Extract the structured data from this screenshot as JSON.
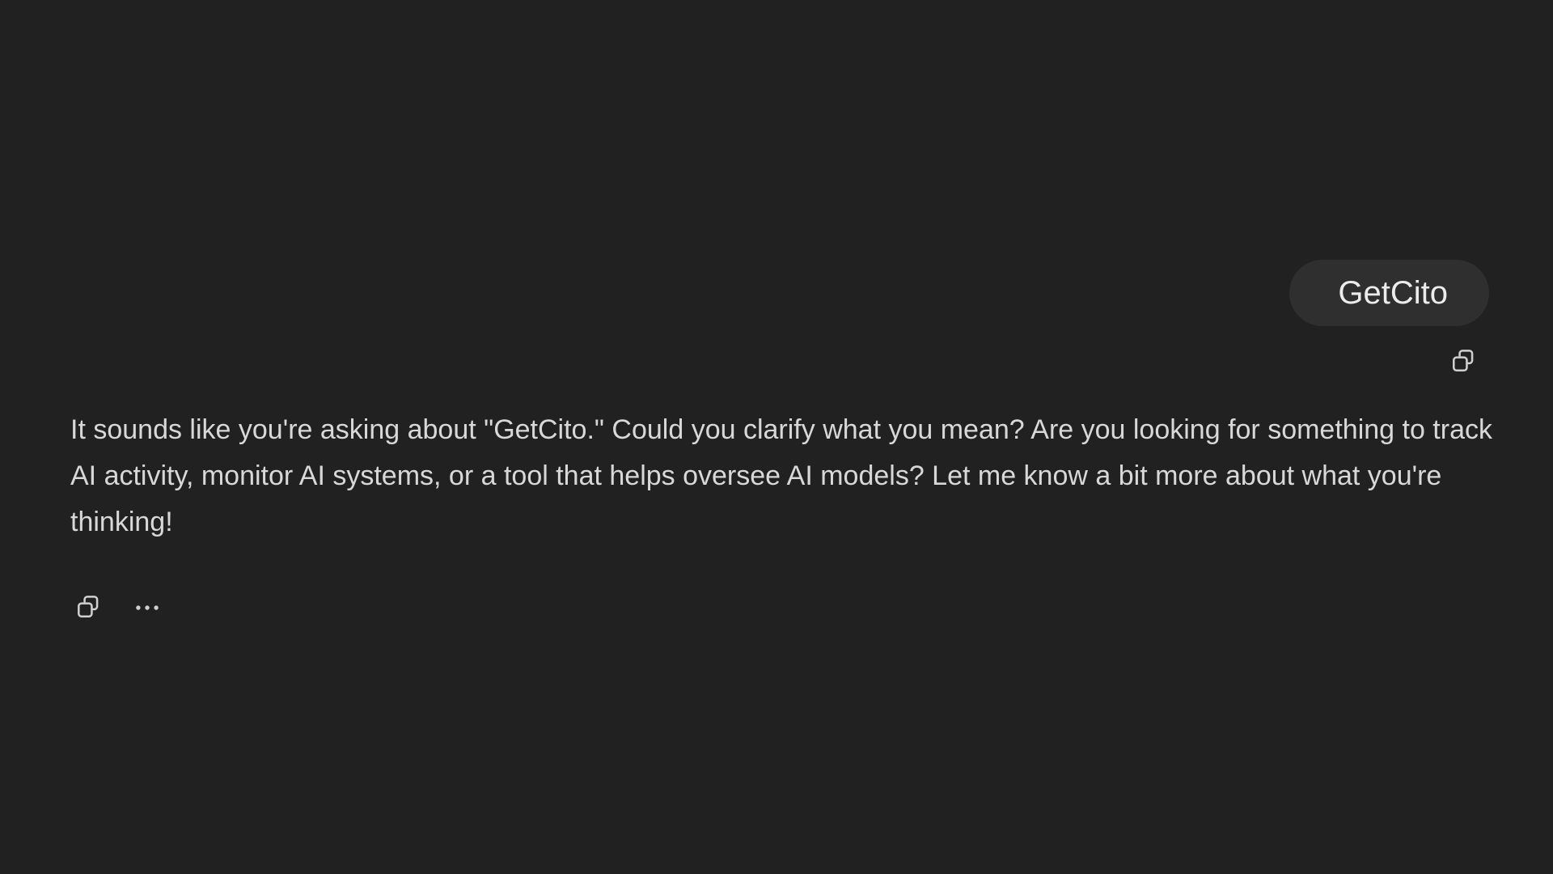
{
  "conversation": {
    "user_message": {
      "text": "GetCito",
      "actions": [
        {
          "icon": "copy-icon"
        }
      ]
    },
    "assistant_message": {
      "text": "It sounds like you're asking about \"GetCito.\" Could you clarify what you mean? Are you looking for something to track AI activity, monitor AI systems, or a tool that helps oversee AI models? Let me know a bit more about what you're thinking!",
      "actions": [
        {
          "icon": "copy-icon"
        },
        {
          "icon": "more-options-icon"
        }
      ]
    }
  },
  "colors": {
    "background": "#212121",
    "user_bubble": "#2f2f2f",
    "user_text": "#ececec",
    "assistant_text": "#d8d8d8",
    "icon": "#d0d0d0"
  }
}
